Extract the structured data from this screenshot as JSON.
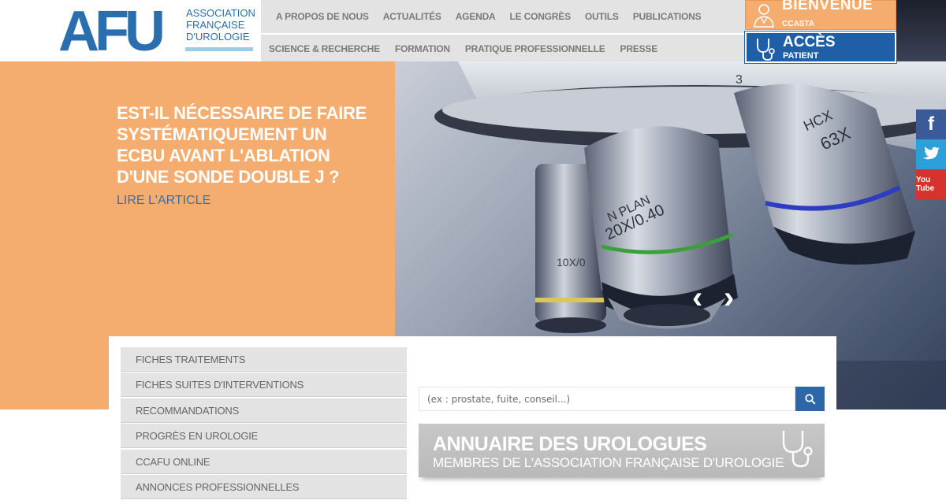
{
  "logo": {
    "mark": "AFU",
    "line1": "ASSOCIATION",
    "line2": "FRANÇAISE",
    "line3": "D'UROLOGIE"
  },
  "nav": {
    "row1": [
      "A PROPOS DE NOUS",
      "ACTUALITÉS",
      "AGENDA",
      "LE CONGRÈS",
      "OUTILS",
      "PUBLICATIONS"
    ],
    "row2": [
      "SCIENCE & RECHERCHE",
      "FORMATION",
      "PRATIQUE PROFESSIONNELLE",
      "PRESSE"
    ]
  },
  "welcome": {
    "title": "BIENVENUE",
    "user": "CCASTA",
    "icon": "doctor-icon"
  },
  "patient": {
    "title": "ACCÈS",
    "sub": "PATIENT",
    "icon": "stethoscope-icon"
  },
  "hero": {
    "title": "EST-IL NÉCESSAIRE DE FAIRE SYSTÉMATIQUEMENT UN ECBU AVANT L'ABLATION D'UNE SONDE DOUBLE J ?",
    "link": "LIRE L'ARTICLE",
    "prev": "‹",
    "next": "›",
    "photo_labels": [
      "N PLAN",
      "20X/0.40",
      "HCX",
      "63X",
      "10X/0",
      "3"
    ]
  },
  "social": {
    "facebook": "f",
    "twitter_icon": "bird-icon",
    "youtube": "You Tube"
  },
  "menu": [
    "FICHES TRAITEMENTS",
    "FICHES SUITES D'INTERVENTIONS",
    "RECOMMANDATIONS",
    "PROGRÈS EN UROLOGIE",
    "CCAFU ONLINE",
    "ANNONCES PROFESSIONNELLES"
  ],
  "search": {
    "placeholder": "(ex : prostate, fuite, conseil...)",
    "value": "",
    "icon": "search-icon"
  },
  "annuaire": {
    "title": "ANNUAIRE DES UROLOGUES",
    "sub": "MEMBRES DE L'ASSOCIATION FRANÇAISE D'UROLOGIE",
    "icon": "stethoscope-icon"
  },
  "colors": {
    "orange": "#f5ac6f",
    "blue": "#1f5fa8",
    "nav_bg": "#e3e3e3",
    "nav_text": "#7b7b7b",
    "link_blue": "#3c6fa5"
  }
}
